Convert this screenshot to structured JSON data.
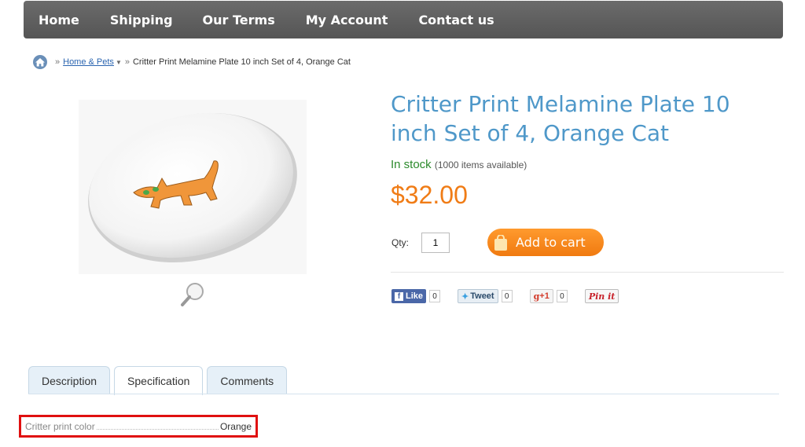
{
  "nav": {
    "items": [
      "Home",
      "Shipping",
      "Our Terms",
      "My Account",
      "Contact us"
    ]
  },
  "breadcrumb": {
    "separator": "»",
    "category": "Home & Pets",
    "current": "Critter Print Melamine Plate 10 inch Set of 4, Orange Cat"
  },
  "product": {
    "title": "Critter Print Melamine Plate 10 inch Set of 4, Orange Cat",
    "stock_status": "In stock",
    "stock_available": "(1000 items available)",
    "price": "$32.00",
    "qty_label": "Qty:",
    "qty_value": "1",
    "add_to_cart": "Add to cart"
  },
  "social": {
    "facebook": {
      "label": "Like",
      "count": "0"
    },
    "twitter": {
      "label": "Tweet",
      "count": "0"
    },
    "googleplus": {
      "label": "+1",
      "count": "0"
    },
    "pinterest": {
      "label": "Pin it"
    }
  },
  "tabs": [
    {
      "label": "Description",
      "active": false
    },
    {
      "label": "Specification",
      "active": true
    },
    {
      "label": "Comments",
      "active": false
    }
  ],
  "specification": {
    "key": "Critter print color",
    "value": "Orange"
  },
  "colors": {
    "title": "#4f98c9",
    "price": "#f07c16",
    "in_stock": "#2b8a2b",
    "highlight_border": "#e01010",
    "nav_bg": "#606060"
  }
}
